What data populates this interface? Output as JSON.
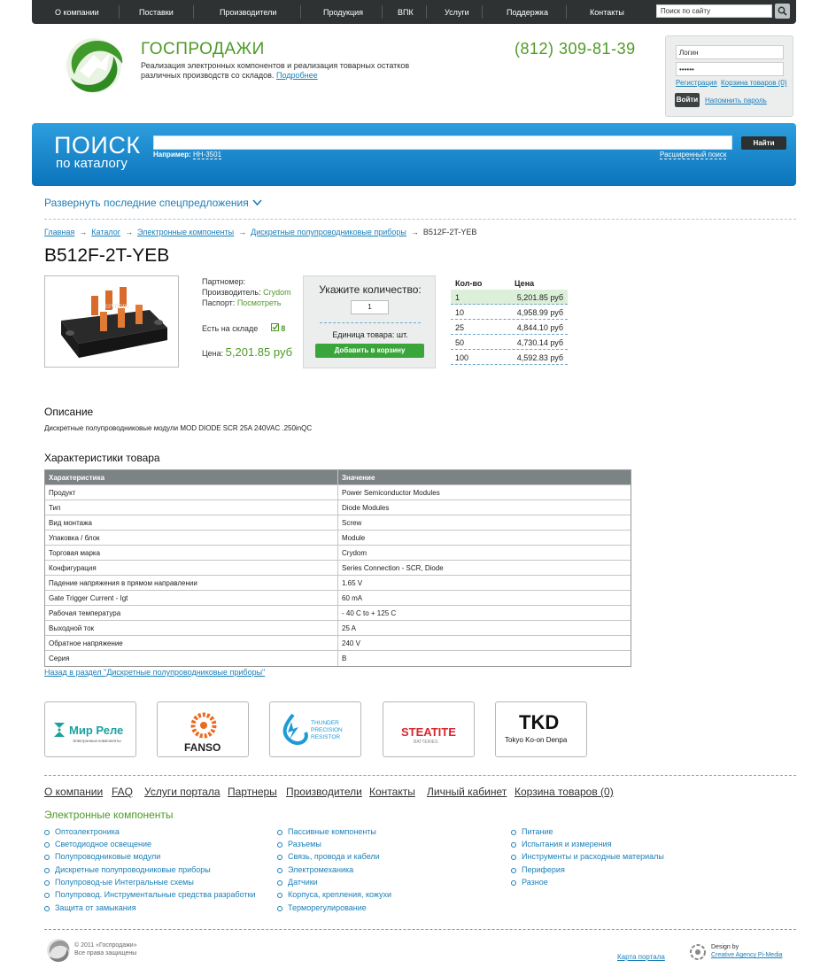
{
  "topnav": {
    "items": [
      "О компании",
      "Поставки",
      "Производители",
      "Продукция",
      "ВПК",
      "Услуги",
      "Поддержка",
      "Контакты"
    ],
    "search_placeholder": "Поиск по сайту"
  },
  "header": {
    "brand": "ГОСПРОДАЖИ",
    "tagline": "Реализация электронных компонентов и реализация товарных остатков различных производств со складов.",
    "more_link": "Подробнее",
    "phone": "(812) 309-81-39"
  },
  "login": {
    "login_value": "Логин",
    "password_value": "••••••",
    "register": "Регистрация",
    "cart": "Корзина товаров (0)",
    "submit": "Войти",
    "forgot": "Напомнить пароль"
  },
  "catalog_search": {
    "title_line1": "ПОИСК",
    "title_line2": "по каталогу",
    "example_label": "Например:",
    "example_value": "НН-3501",
    "button": "Найти",
    "advanced": "Расширенный поиск"
  },
  "deals_toggle": "Развернуть последние спецпредложения",
  "breadcrumb": {
    "items": [
      "Главная",
      "Каталог",
      "Электронные компоненты",
      "Дискретные полупроводниковые приборы"
    ],
    "current": "B512F-2T-YEB"
  },
  "product": {
    "title": "B512F-2T-YEB",
    "partnumber_label": "Партномер:",
    "manufacturer_label": "Производитель:",
    "manufacturer": "Crydom",
    "passport_label": "Паспорт:",
    "passport_link": "Посмотреть",
    "stock_label": "Есть на складе",
    "stock_count": "8",
    "price_label": "Цена:",
    "price": "5,201.85 руб",
    "photo_text": "crydom"
  },
  "quantity": {
    "title": "Укажите количество:",
    "value": "1",
    "unit": "Единица товара: шт.",
    "add_button": "Добавить в корзину"
  },
  "price_table": {
    "headers": [
      "Кол-во",
      "Цена"
    ],
    "rows": [
      {
        "qty": "1",
        "price": "5,201.85 руб"
      },
      {
        "qty": "10",
        "price": "4,958.99 руб"
      },
      {
        "qty": "25",
        "price": "4,844.10 руб"
      },
      {
        "qty": "50",
        "price": "4,730.14 руб"
      },
      {
        "qty": "100",
        "price": "4,592.83 руб"
      }
    ]
  },
  "description": {
    "title": "Описание",
    "text": "Дискретные полупроводниковые модули MOD DIODE SCR 25A 240VAC .250inQC"
  },
  "specs": {
    "title": "Характеристики товара",
    "headers": [
      "Характеристика",
      "Значение"
    ],
    "rows": [
      [
        "Продукт",
        "Power Semiconductor Modules"
      ],
      [
        "Тип",
        "Diode Modules"
      ],
      [
        "Вид монтажа",
        "Screw"
      ],
      [
        "Упаковка / блок",
        "Module"
      ],
      [
        "Торговая марка",
        "Crydom"
      ],
      [
        "Конфигурация",
        "Series Connection - SCR, Diode"
      ],
      [
        "Падение напряжения в прямом направлении",
        "1.65 V"
      ],
      [
        "Gate Trigger Current - Igt",
        "60 mA"
      ],
      [
        "Рабочая температура",
        "- 40 C to + 125 C"
      ],
      [
        "Выходной ток",
        "25 A"
      ],
      [
        "Обратное напряжение",
        "240 V"
      ],
      [
        "Серия",
        "B"
      ]
    ],
    "back_link": "Назад в раздел \"Дискретные полупроводниковые приборы\""
  },
  "brands": {
    "mir_rele": "Мир Реле",
    "mir_rele_sub": "Электронные компоненты",
    "fanso": "FANSO",
    "thunder": [
      "THUNDER",
      "PRECISION",
      "RESISTOR"
    ],
    "steatite": "STEATITE",
    "steatite_sub": "BATTERIES",
    "tkd": "TKD",
    "tkd_sub": "Tokyo Ko-on Denpa"
  },
  "footer": {
    "nav": [
      "О компании",
      "FAQ",
      "Услуги портала",
      "Партнеры",
      "Производители",
      "Контакты",
      "Личный кабинет",
      "Корзина товаров (0)"
    ],
    "category_title": "Электронные компоненты",
    "col1": [
      "Оптоэлектроника",
      "Светодиодное освещение",
      "Полупроводниковые модули",
      "Дискретные полупроводниковые приборы",
      "Полупровод-ые Интегральные схемы",
      "Полупровод. Инструментальные средства разработки",
      "Защита от замыкания"
    ],
    "col2": [
      "Пассивные компоненты",
      "Разъемы",
      "Связь, провода и кабели",
      "Электромеханика",
      "Датчики",
      "Корпуса, крепления, кожухи",
      "Терморегулирование"
    ],
    "col3": [
      "Питание",
      "Испытания и измерения",
      "Инструменты и расходные материалы",
      "Периферия",
      "Разное"
    ],
    "copyright_line1": "© 2011 «Госпродажи»",
    "copyright_line2": "Все права защищены",
    "sitemap": "Карта портала",
    "design_line1": "Design by",
    "design_line2": "Creative Agency Pi-Media"
  },
  "colors": {
    "accent_green": "#4e9a27",
    "link_blue": "#1b7fb8",
    "panel_blue": "#1a8ccd",
    "dark_nav": "#2e3233"
  }
}
